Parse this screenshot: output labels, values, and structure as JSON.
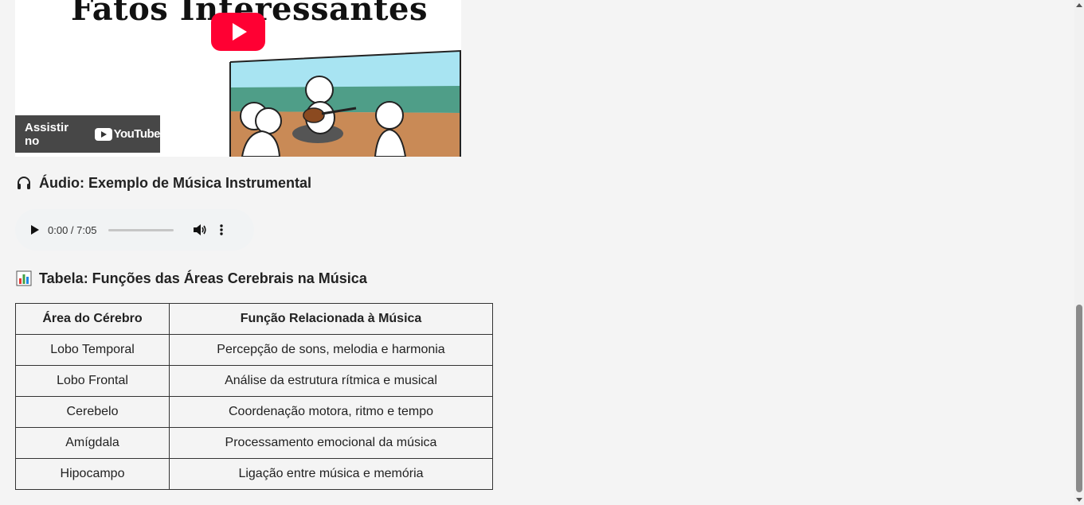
{
  "video": {
    "title_text": "Fatos Interessantes",
    "watch_label": "Assistir no",
    "youtube_word": "YouTube"
  },
  "audio_section": {
    "heading": "Áudio: Exemplo de Música Instrumental",
    "icon": "headphones-icon",
    "time": "0:00 / 7:05"
  },
  "table_section": {
    "heading": "Tabela: Funções das Áreas Cerebrais na Música",
    "icon": "bar-chart-icon",
    "headers": [
      "Área do Cérebro",
      "Função Relacionada à Música"
    ],
    "rows": [
      [
        "Lobo Temporal",
        "Percepção de sons, melodia e harmonia"
      ],
      [
        "Lobo Frontal",
        "Análise da estrutura rítmica e musical"
      ],
      [
        "Cerebelo",
        "Coordenação motora, ritmo e tempo"
      ],
      [
        "Amígdala",
        "Processamento emocional da música"
      ],
      [
        "Hipocampo",
        "Ligação entre música e memória"
      ]
    ]
  },
  "colors": {
    "youtube_red": "#ff0033",
    "page_bg": "#f4f4f4"
  }
}
